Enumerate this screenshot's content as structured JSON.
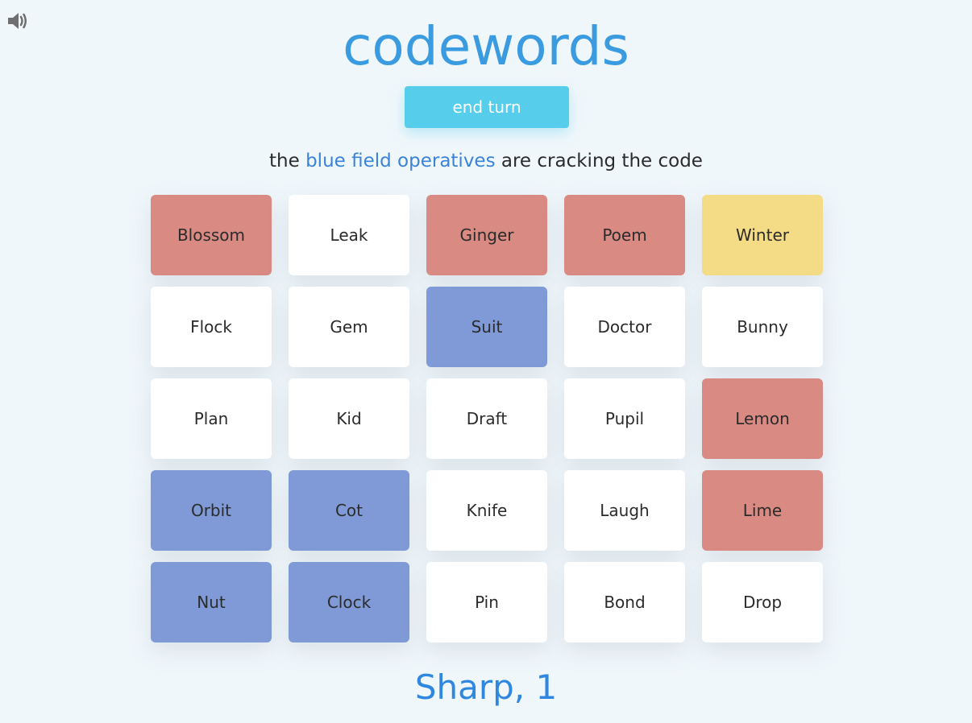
{
  "app": {
    "title": "codewords",
    "sound_icon": "speaker-volume-icon"
  },
  "controls": {
    "end_turn_label": "end turn"
  },
  "status": {
    "prefix": "the ",
    "team": "blue field operatives",
    "suffix": " are cracking the code",
    "team_color": "#3a83d6"
  },
  "colors": {
    "background": "#f0f7fb",
    "title": "#3a9be0",
    "end_turn": "#55cdeb",
    "red": "#d88a83",
    "blue": "#7f9ad6",
    "neutral": "#ffffff",
    "assassin": "#f4dc87",
    "clue": "#2f87e0"
  },
  "board": [
    {
      "word": "Blossom",
      "state": "red"
    },
    {
      "word": "Leak",
      "state": "neutral"
    },
    {
      "word": "Ginger",
      "state": "red"
    },
    {
      "word": "Poem",
      "state": "red"
    },
    {
      "word": "Winter",
      "state": "yellow"
    },
    {
      "word": "Flock",
      "state": "neutral"
    },
    {
      "word": "Gem",
      "state": "neutral"
    },
    {
      "word": "Suit",
      "state": "blue"
    },
    {
      "word": "Doctor",
      "state": "neutral"
    },
    {
      "word": "Bunny",
      "state": "neutral"
    },
    {
      "word": "Plan",
      "state": "neutral"
    },
    {
      "word": "Kid",
      "state": "neutral"
    },
    {
      "word": "Draft",
      "state": "neutral"
    },
    {
      "word": "Pupil",
      "state": "neutral"
    },
    {
      "word": "Lemon",
      "state": "red"
    },
    {
      "word": "Orbit",
      "state": "blue"
    },
    {
      "word": "Cot",
      "state": "blue"
    },
    {
      "word": "Knife",
      "state": "neutral"
    },
    {
      "word": "Laugh",
      "state": "neutral"
    },
    {
      "word": "Lime",
      "state": "red"
    },
    {
      "word": "Nut",
      "state": "blue"
    },
    {
      "word": "Clock",
      "state": "blue"
    },
    {
      "word": "Pin",
      "state": "neutral"
    },
    {
      "word": "Bond",
      "state": "neutral"
    },
    {
      "word": "Drop",
      "state": "neutral"
    }
  ],
  "clue": {
    "text": "Sharp, 1"
  }
}
